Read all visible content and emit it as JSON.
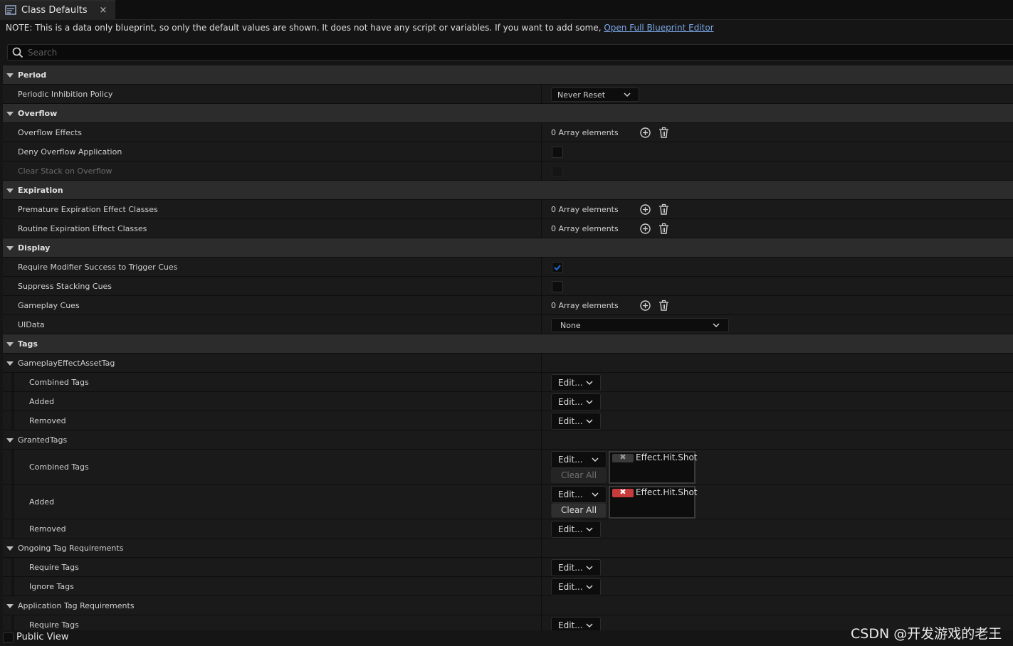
{
  "tab": {
    "title": "Class Defaults",
    "close_glyph": "×",
    "icon": "blueprint-icon"
  },
  "note": {
    "text": "NOTE: This is a data only blueprint, so only the default values are shown.  It does not have any script or variables.  If you want to add some, ",
    "link": "Open Full Blueprint Editor"
  },
  "search": {
    "placeholder": "Search"
  },
  "sections": {
    "period": {
      "label": "Period",
      "periodic_inhibition_policy": {
        "label": "Periodic Inhibition Policy",
        "value": "Never Reset"
      }
    },
    "overflow": {
      "label": "Overflow",
      "overflow_effects": {
        "label": "Overflow Effects",
        "value": "0 Array elements"
      },
      "deny_overflow_application": {
        "label": "Deny Overflow Application",
        "checked": false
      },
      "clear_stack_on_overflow": {
        "label": "Clear Stack on Overflow",
        "checked": false,
        "disabled": true
      }
    },
    "expiration": {
      "label": "Expiration",
      "premature": {
        "label": "Premature Expiration Effect Classes",
        "value": "0 Array elements"
      },
      "routine": {
        "label": "Routine Expiration Effect Classes",
        "value": "0 Array elements"
      }
    },
    "display": {
      "label": "Display",
      "require_modifier_success": {
        "label": "Require Modifier Success to Trigger Cues",
        "checked": true
      },
      "suppress_stacking_cues": {
        "label": "Suppress Stacking Cues",
        "checked": false
      },
      "gameplay_cues": {
        "label": "Gameplay Cues",
        "value": "0 Array elements"
      },
      "uidata": {
        "label": "UIData",
        "value": "None"
      }
    },
    "tags": {
      "label": "Tags",
      "asset_tag": {
        "label": "GameplayEffectAssetTag",
        "combined": "Combined Tags",
        "added": "Added",
        "removed": "Removed"
      },
      "granted_tags": {
        "label": "GrantedTags",
        "combined": "Combined Tags",
        "added": "Added",
        "removed": "Removed",
        "tag_value": "Effect.Hit.Shot",
        "clear_all": "Clear All"
      },
      "ongoing": {
        "label": "Ongoing Tag Requirements",
        "require": "Require Tags",
        "ignore": "Ignore Tags"
      },
      "application": {
        "label": "Application Tag Requirements",
        "require": "Require Tags"
      }
    }
  },
  "edit_label": "Edit...",
  "tag_remove_glyph": "✖",
  "bottom": {
    "public_view": "Public View"
  },
  "watermark": "CSDN @开发游戏的老王",
  "colors": {
    "accent_check": "#1e6fd9",
    "tag_remove_active": "#c83b3b",
    "link": "#7aa7e6"
  }
}
